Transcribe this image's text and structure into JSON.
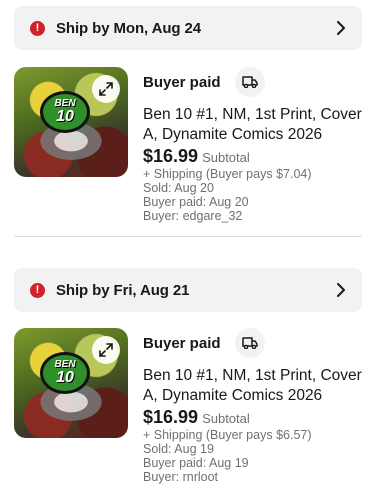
{
  "colors": {
    "alert": "#d1212b",
    "bar_bg": "#f2f2f2",
    "meta_text": "#707070"
  },
  "orders": [
    {
      "ship_by": "Ship by Mon, Aug 24",
      "status": "Buyer paid",
      "title": "Ben 10 #1, NM, 1st Print, Cover A, Dynamite Comics 2026",
      "price": "$16.99",
      "price_note": "Subtotal",
      "shipping": "+ Shipping (Buyer pays $7.04)",
      "sold": "Sold: Aug 20",
      "buyer_paid_date": "Buyer paid: Aug 20",
      "buyer": "Buyer: edgare_32",
      "thumb_logo_top": "BEN",
      "thumb_logo_bottom": "10"
    },
    {
      "ship_by": "Ship by Fri, Aug 21",
      "status": "Buyer paid",
      "title": "Ben 10 #1, NM, 1st Print, Cover A, Dynamite Comics 2026",
      "price": "$16.99",
      "price_note": "Subtotal",
      "shipping": "+ Shipping (Buyer pays $6.57)",
      "sold": "Sold: Aug 19",
      "buyer_paid_date": "Buyer paid: Aug 19",
      "buyer": "Buyer: rnrloot",
      "thumb_logo_top": "BEN",
      "thumb_logo_bottom": "10"
    }
  ],
  "icons": {
    "alert": "alert-icon",
    "chevron": "chevron-right-icon",
    "expand": "expand-icon",
    "truck": "truck-icon"
  }
}
